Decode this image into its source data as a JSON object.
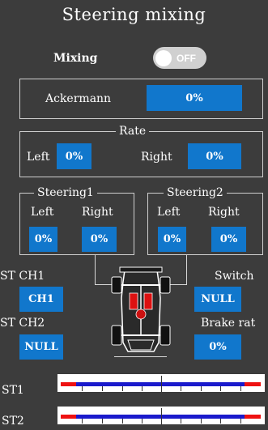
{
  "header": {
    "title": "Steering mixing"
  },
  "mixing": {
    "label": "Mixing",
    "toggle_state": "OFF"
  },
  "ackermann": {
    "label": "Ackermann",
    "value": "0%"
  },
  "rate": {
    "title": "Rate",
    "left_label": "Left",
    "left_value": "0%",
    "right_label": "Right",
    "right_value": "0%"
  },
  "steering1": {
    "title": "Steering1",
    "left_label": "Left",
    "right_label": "Right",
    "left_value": "0%",
    "right_value": "0%"
  },
  "steering2": {
    "title": "Steering2",
    "left_label": "Left",
    "right_label": "Right",
    "left_value": "0%",
    "right_value": "0%"
  },
  "st_ch1": {
    "label": "ST CH1",
    "value": "CH1"
  },
  "st_ch2": {
    "label": "ST CH2",
    "value": "NULL"
  },
  "switch": {
    "label": "Switch",
    "value": "NULL"
  },
  "brake_rate": {
    "label": "Brake rat",
    "value": "0%"
  },
  "channels": [
    {
      "label": "ST1"
    },
    {
      "label": "ST2"
    }
  ],
  "colors": {
    "background": "#3c3c3c",
    "accent": "#1177cc",
    "bar": "#1a1acc",
    "limit": "#ee1111"
  }
}
